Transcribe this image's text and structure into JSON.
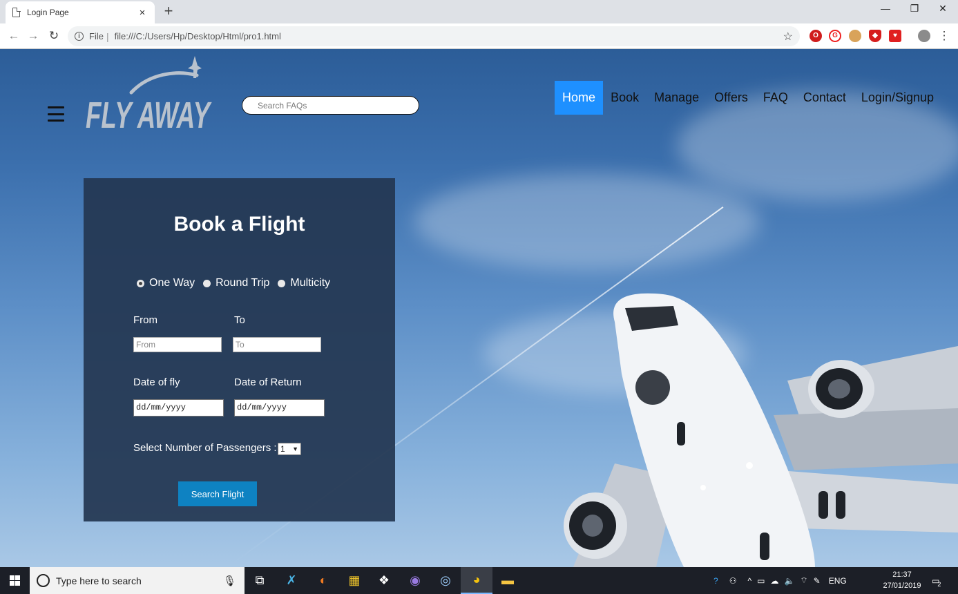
{
  "browser": {
    "tab_title": "Login Page",
    "tab_close": "×",
    "new_tab": "+",
    "url_scheme": "File",
    "url_sep": "|",
    "url": "file:///C:/Users/Hp/Desktop/Html/pro1.html",
    "minimize": "—",
    "maximize": "❐",
    "close": "✕"
  },
  "header": {
    "logo_text": "FLY AWAY",
    "search_placeholder": "Search FAQs",
    "nav": [
      "Home",
      "Book",
      "Manage",
      "Offers",
      "FAQ",
      "Contact",
      "Login/Signup"
    ],
    "active_nav": "Home"
  },
  "booking": {
    "title": "Book a Flight",
    "trip_types": [
      "One Way",
      "Round Trip",
      "Multicity"
    ],
    "selected_trip": "One Way",
    "from_label": "From",
    "from_placeholder": "From",
    "to_label": "To",
    "to_placeholder": "To",
    "date_fly_label": "Date of fly",
    "date_fly_value": "dd/mm/yyyy",
    "date_return_label": "Date of Return",
    "date_return_value": "dd/mm/yyyy",
    "passengers_label": "Select Number of Passengers :",
    "passengers_value": "1",
    "search_button": "Search Flight"
  },
  "taskbar": {
    "search_placeholder": "Type here to search",
    "language": "ENG",
    "time": "21:37",
    "date": "27/01/2019",
    "notification_count": "2"
  },
  "colors": {
    "nav_active": "#1e90ff",
    "panel_bg": "#233752",
    "button_bg": "#0e82c2"
  }
}
